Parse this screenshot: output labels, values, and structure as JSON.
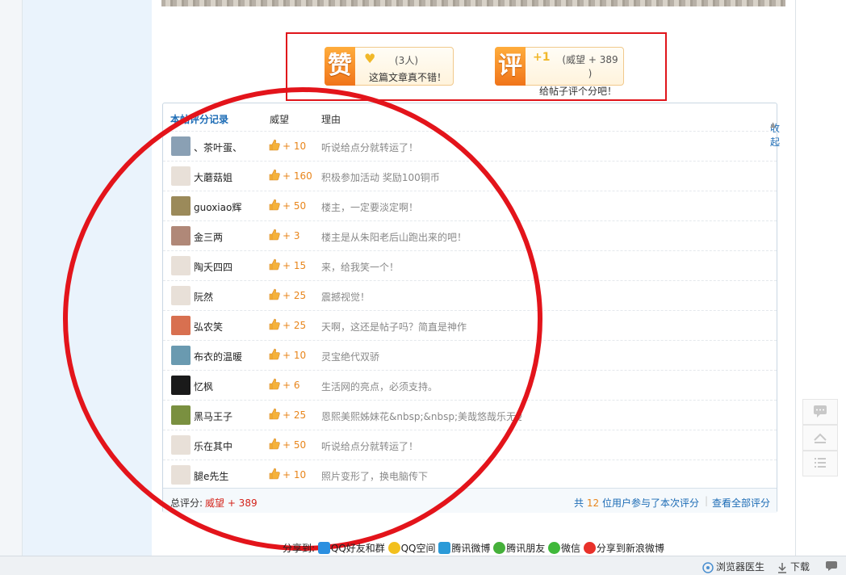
{
  "rate_buttons": {
    "zan": {
      "icon_char": "赞",
      "count": "(3人)",
      "text": "这篇文章真不错！"
    },
    "ping": {
      "icon_char": "评",
      "plus": "+1",
      "text": "(威望 + 389 )",
      "subtext": "给帖子评个分吧！"
    }
  },
  "table": {
    "header": {
      "title": "本帖评分记录",
      "col_weiwang": "威望",
      "col_reason": "理由",
      "collapse": "收起"
    },
    "rows": [
      {
        "user": "、茶叶蛋、",
        "score": "+ 10",
        "reason": "听说给点分就转运了！"
      },
      {
        "user": "大蘑菇姐",
        "score": "+ 160",
        "reason": "积极参加活动 奖励100铜币"
      },
      {
        "user": "guoxiao辉",
        "score": "+ 50",
        "reason": "楼主，一定要淡定啊！"
      },
      {
        "user": "金三两",
        "score": "+ 3",
        "reason": "楼主是从朱阳老后山跑出来的吧！"
      },
      {
        "user": "陶夭四四",
        "score": "+ 15",
        "reason": "来，给我笑一个！"
      },
      {
        "user": "阮然",
        "score": "+ 25",
        "reason": "震撼视觉！"
      },
      {
        "user": "弘农笑",
        "score": "+ 25",
        "reason": "天啊，这还是帖子吗？简直是神作"
      },
      {
        "user": "布衣的温暖",
        "score": "+ 10",
        "reason": "灵宝绝代双骄"
      },
      {
        "user": "忆枫",
        "score": "+ 6",
        "reason": "生活网的亮点，必须支持。"
      },
      {
        "user": "黑马王子",
        "score": "+ 25",
        "reason": "恩熙美熙姊妹花&nbsp;&nbsp;美哉悠哉乐无边"
      },
      {
        "user": "乐在其中",
        "score": "+ 50",
        "reason": "听说给点分就转运了！"
      },
      {
        "user": "腿e先生",
        "score": "+ 10",
        "reason": "照片变形了，换电脑传下"
      }
    ],
    "footer": {
      "total_label": "总评分:",
      "total_value": "威望 + 389",
      "participants_pre": "共",
      "participants_count": "12",
      "participants_post": "位用户参与了本次评分",
      "view_all": "查看全部评分"
    }
  },
  "share": {
    "label": "分享到:",
    "items": [
      "QQ好友和群",
      "QQ空间",
      "腾讯微博",
      "腾讯朋友",
      "微信",
      "分享到新浪微博"
    ]
  },
  "statusbar": {
    "doctor": "浏览器医生",
    "download": "下载"
  },
  "colors": {
    "accent_orange": "#f0741a",
    "link_blue": "#1b6bb5",
    "annotation_red": "#e3141b",
    "score_orange": "#e8851b"
  },
  "avatars": [
    "#8aa0b4",
    "#e8e0d8",
    "#9b8a5a",
    "#b08878",
    "#e8e0d8",
    "#e8e0d8",
    "#d87050",
    "#6a9ab0",
    "#1a1a1a",
    "#7a9040",
    "#e8e0d8",
    "#e8e0d8"
  ]
}
